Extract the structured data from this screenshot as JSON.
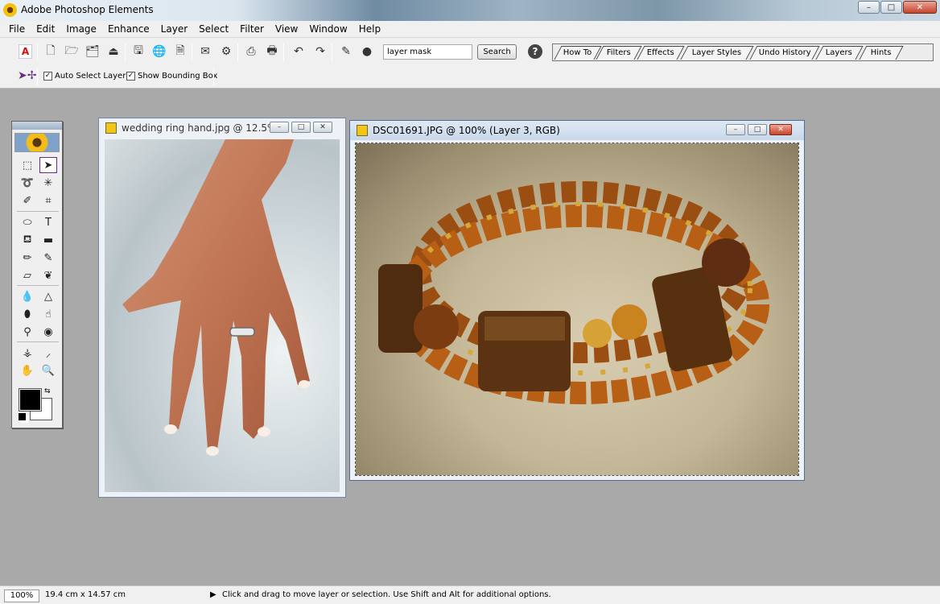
{
  "window": {
    "title": "Adobe Photoshop Elements",
    "min": "–",
    "max": "□",
    "close": "✕"
  },
  "menu": [
    "File",
    "Edit",
    "Image",
    "Enhance",
    "Layer",
    "Select",
    "Filter",
    "View",
    "Window",
    "Help"
  ],
  "shortcuts": {
    "search_value": "layer mask",
    "search_button": "Search",
    "help": "?"
  },
  "palette_tabs": [
    "How To",
    "Filters",
    "Effects",
    "Layer Styles",
    "Undo History",
    "Layers",
    "Hints"
  ],
  "options": {
    "auto_select_layer": "Auto Select Layer",
    "show_bounding_box": "Show Bounding Box",
    "auto_select_checked": true,
    "bounding_box_checked": true
  },
  "documents": [
    {
      "title": "wedding ring hand.jpg @ 12.5%..."
    },
    {
      "title": "DSC01691.JPG @ 100% (Layer 3, RGB)"
    }
  ],
  "status": {
    "zoom": "100%",
    "dimensions": "19.4 cm x 14.57 cm",
    "hint": "Click and drag to move layer or selection. Use Shift and Alt for additional options."
  },
  "colors": {
    "foreground": "#000000",
    "background": "#ffffff",
    "accent": "#6b2a86"
  }
}
